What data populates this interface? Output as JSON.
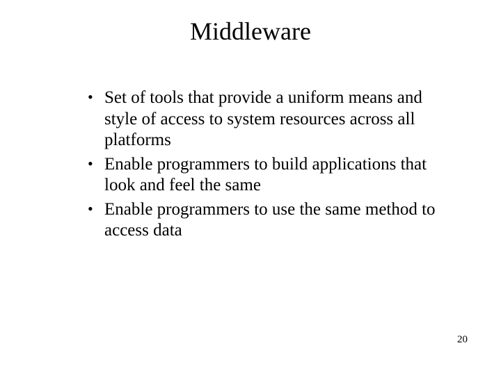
{
  "title": "Middleware",
  "bullets": [
    "Set of tools that provide a uniform means and style of access to system resources across all platforms",
    "Enable programmers to build applications that look and feel the same",
    "Enable programmers to use the same method to access data"
  ],
  "page_number": "20"
}
